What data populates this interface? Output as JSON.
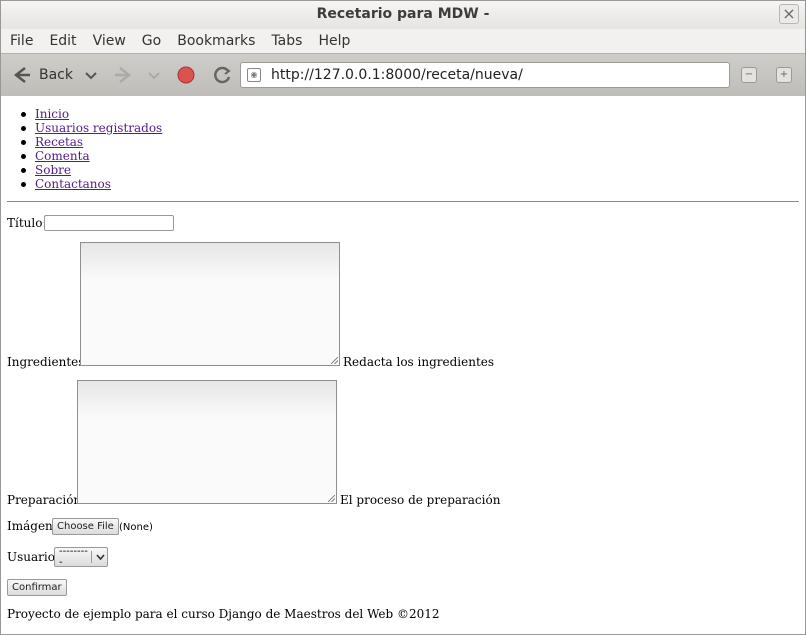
{
  "window": {
    "title": "Recetario para MDW -",
    "close_glyph": "×"
  },
  "menubar": {
    "items": [
      "File",
      "Edit",
      "View",
      "Go",
      "Bookmarks",
      "Tabs",
      "Help"
    ]
  },
  "toolbar": {
    "back_label": "Back",
    "url": "http://127.0.0.1:8000/receta/nueva/",
    "icons": [
      "back-arrow-icon",
      "back-dropdown-icon",
      "forward-arrow-icon",
      "forward-dropdown-icon",
      "stop-icon",
      "reload-icon",
      "page-icon",
      "zoom-out-icon",
      "zoom-in-icon"
    ],
    "stop_color": "#d9534f"
  },
  "nav": {
    "links": [
      "Inicio",
      "Usuarios registrados",
      "Recetas",
      "Comenta",
      "Sobre",
      "Contactanos"
    ]
  },
  "form": {
    "titulo_label": "Título:",
    "titulo_value": "",
    "ingredientes_label": "Ingredientes:",
    "ingredientes_help": "Redacta los ingredientes",
    "preparacion_label": "Preparación:",
    "preparacion_help": "El proceso de preparación",
    "imagen_label": "Imágen:",
    "file_button": "Choose File",
    "file_status": "(None)",
    "usuario_label": "Usuario:",
    "usuario_selected": "---------",
    "submit_label": "Confirmar"
  },
  "footer": {
    "text": "Proyecto de ejemplo para el curso Django de Maestros del Web ©2012"
  }
}
